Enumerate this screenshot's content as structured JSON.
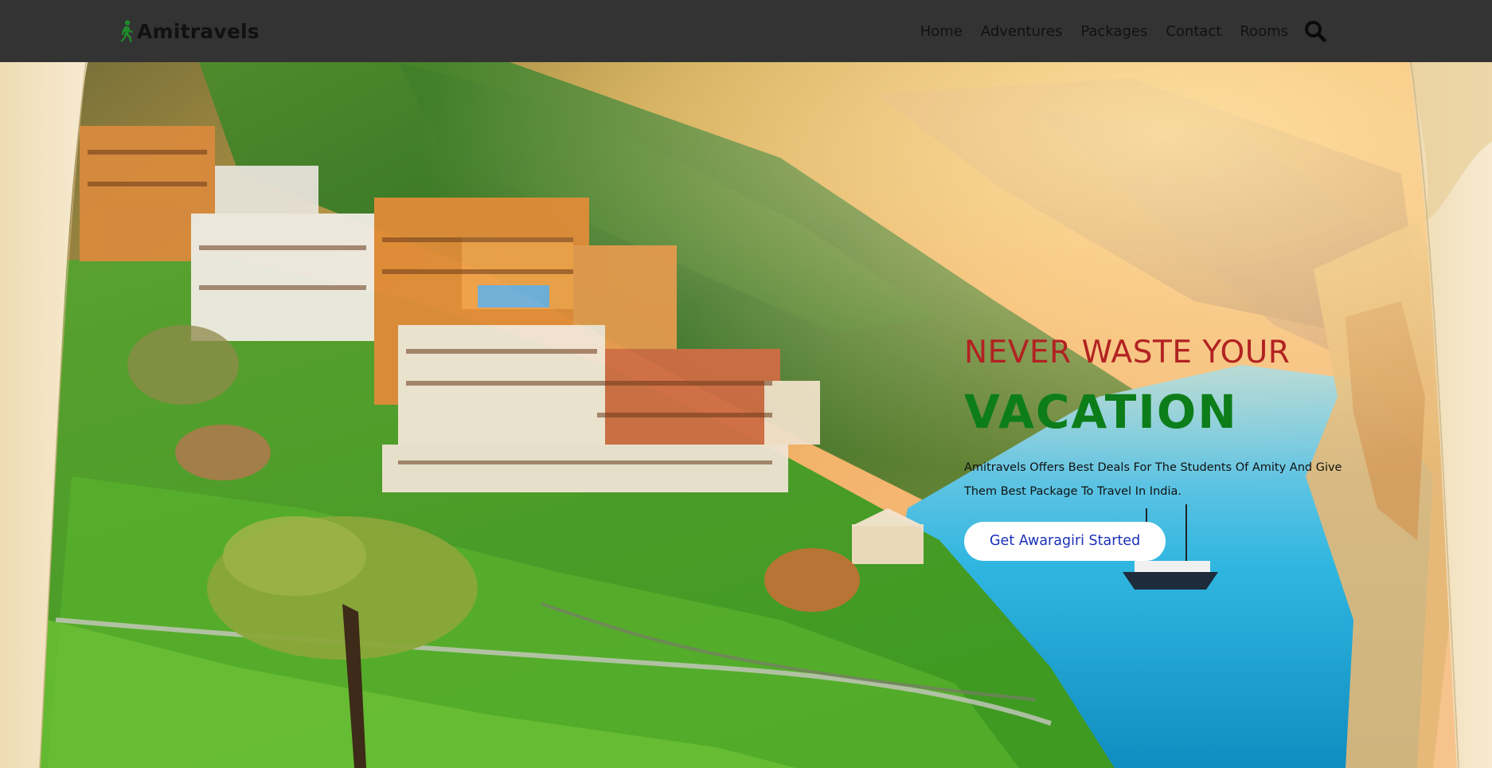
{
  "brand": {
    "name": "Amitravels",
    "logo_icon": "walking-person-icon",
    "logo_color": "#1f8a2a"
  },
  "nav": {
    "items": [
      {
        "label": "Home"
      },
      {
        "label": "Adventures"
      },
      {
        "label": "Packages"
      },
      {
        "label": "Contact"
      },
      {
        "label": "Rooms"
      }
    ],
    "search_icon": "search-icon"
  },
  "hero": {
    "title_top": "NEVER WASTE YOUR",
    "title_main": "VACATION",
    "description": "Amitravels Offers Best Deals For The Students Of Amity And Give Them Best Package To Travel In India.",
    "cta_label": "Get Awaragiri Started",
    "background": "hill-station-valley-lake-scene"
  },
  "colors": {
    "header_bg": "#333333",
    "title_top": "#b22222",
    "title_main": "#0d7d1a",
    "cta_bg": "#ffffff",
    "cta_text": "#1a2fb8"
  }
}
